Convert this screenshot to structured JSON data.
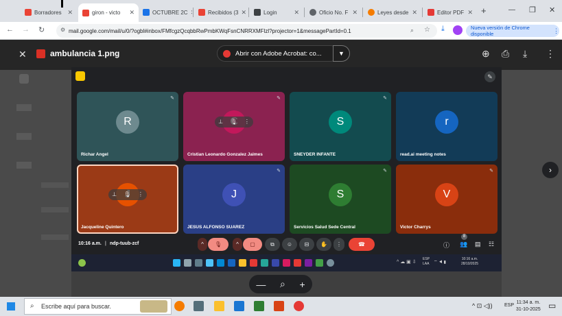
{
  "browser": {
    "tabs": [
      {
        "label": "Borradores",
        "color": "#ea4335"
      },
      {
        "label": "giron - victo",
        "color": "#ea4335",
        "active": true
      },
      {
        "label": "OCTUBRE 2C",
        "color": "#1a73e8"
      },
      {
        "label": "Recibidos (3",
        "color": "#ea4335"
      },
      {
        "label": "Login",
        "color": "#3c4043"
      },
      {
        "label": "Oficio No. F",
        "color": "#5f6368"
      },
      {
        "label": "Leyes desde",
        "color": "#f57c00"
      },
      {
        "label": "Editor PDF",
        "color": "#e53935"
      }
    ],
    "new_tab": "+",
    "window_controls": {
      "minimize": "—",
      "maximize": "❐",
      "close": "✕"
    },
    "url": "mail.google.com/mail/u/0/?ogbl#inbox/FMfcgzQcqbbRwPmbKWqFsnCNRRXMFlzl?projector=1&messagePartId=0.1",
    "update_label": "Nueva versión de Chrome disponible"
  },
  "viewer": {
    "file_title": "ambulancia 1.png",
    "acrobat_label": "Abrir con Adobe Acrobat: co...",
    "close": "✕"
  },
  "meet": {
    "tiles": [
      {
        "name": "Richar Angel",
        "initial": "R",
        "bg": "#2f5458",
        "avatar": "#6e8a8f"
      },
      {
        "name": "Cristian Leonardo Gonzalez Jaimes",
        "initial": "C",
        "bg": "#8b2250",
        "avatar": "#c2185b"
      },
      {
        "name": "SNEYDER INFANTE",
        "initial": "S",
        "bg": "#134b4f",
        "avatar": "#00897b"
      },
      {
        "name": "read.ai meeting notes",
        "initial": "r",
        "bg": "#123b57",
        "avatar": "#1565c0"
      },
      {
        "name": "Jacqueline Quintero",
        "initial": "J",
        "bg": "#9b3a16",
        "avatar": "#e65100"
      },
      {
        "name": "JESUS ALFONSO SUAREZ",
        "initial": "J",
        "bg": "#2a3f86",
        "avatar": "#3f51b5"
      },
      {
        "name": "Servicios Salud Sede Central",
        "initial": "S",
        "bg": "#1d4a22",
        "avatar": "#2e7d32"
      },
      {
        "name": "Victor Charrys",
        "initial": "V",
        "bg": "#8a2d0c",
        "avatar": "#d84315"
      }
    ],
    "time": "10:16 a.m.",
    "meeting_code": "ndp-tuub-zcf",
    "people_count": "8",
    "tray_lang": "ESP",
    "tray_lang2": "LAA",
    "tray_time": "10:16 a.m.",
    "tray_date": "28/10/2025"
  },
  "zoom": {
    "minus": "—",
    "search": "⌕",
    "plus": "+"
  },
  "taskbar": {
    "search_placeholder": "Escribe aquí para buscar.",
    "lang": "ESP",
    "time": "11:34 a. m.",
    "date": "31-10-2025"
  }
}
